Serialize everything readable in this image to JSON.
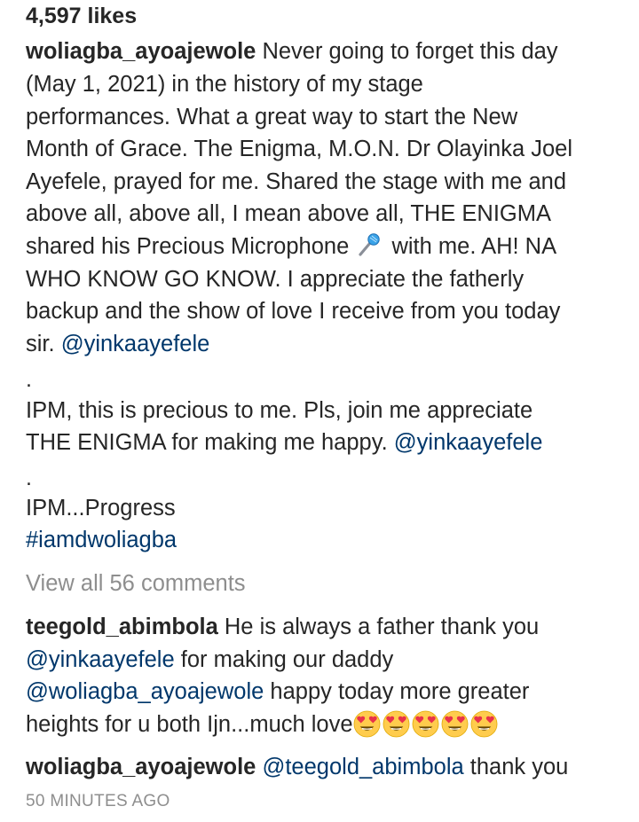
{
  "post": {
    "likes": "4,597 likes",
    "caption_username": "woliagba_ayoajewole",
    "caption_lines": [
      "Never going to forget this day",
      "(May 1, 2021) in the history of my stage",
      "performances. What a great way to start the New",
      "Month of Grace. The Enigma, M.O.N. Dr Olayinka Joel",
      "Ayefele, prayed for me. Shared the stage with me and",
      "above all, above all, I mean above all, THE ENIGMA",
      "shared his Precious Microphone",
      "with me. AH! NA",
      "WHO KNOW GO KNOW. I appreciate the fatherly",
      "backup and the show of love I receive from you today",
      "sir.",
      "@yinkaayefele",
      ".",
      "IPM, this is precious to me. Pls, join me appreciate",
      "THE ENIGMA for making me happy.",
      "@yinkaayefele",
      ".",
      "IPM...Progress",
      "#iamdwoliagba"
    ],
    "view_all_comments": "View all 56 comments",
    "comments": [
      {
        "username": "teegold_abimbola",
        "line1": "He is always a father thank you",
        "mention1": "@yinkaayefele",
        "line2": "for making our daddy",
        "mention2": "@woliagba_ayoajewole",
        "line3": "happy today more greater",
        "line4": "heights for u both Ijn...much love"
      },
      {
        "username": "woliagba_ayoajewole",
        "mention": "@teegold_abimbola",
        "text": "thank you"
      }
    ],
    "timestamp": "50 MINUTES AGO"
  },
  "icons": {
    "microphone": "microphone-emoji-icon",
    "heart_eyes": "heart-eyes-emoji-icon"
  },
  "colors": {
    "text": "#262626",
    "mention": "#00376b",
    "muted": "#8e8e8e"
  }
}
